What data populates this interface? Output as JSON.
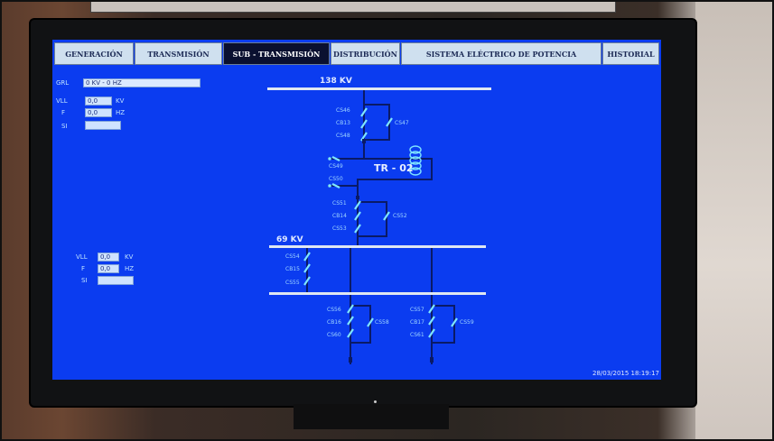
{
  "tabs": [
    {
      "label": "GENERACIÓN",
      "active": false
    },
    {
      "label": "TRANSMISIÓN",
      "active": false
    },
    {
      "label": "SUB - TRANSMISIÓN",
      "active": true
    },
    {
      "label": "DISTRIBUCIÓN",
      "active": false
    },
    {
      "label": "SISTEMA ELÉCTRICO DE POTENCIA",
      "active": false
    },
    {
      "label": "HISTORIAL",
      "active": false
    }
  ],
  "top_panel": {
    "status_label": "GRL",
    "status_value": "0 KV - 0 HZ",
    "vll_label": "VLL",
    "vll_value": "0,0",
    "vll_unit": "KV",
    "f_label": "F",
    "f_value": "0,0",
    "f_unit": "HZ",
    "si_label": "SI",
    "si_value": ""
  },
  "bottom_panel": {
    "vll_label": "VLL",
    "vll_value": "0,0",
    "vll_unit": "KV",
    "f_label": "F",
    "f_value": "0,0",
    "f_unit": "HZ",
    "si_label": "SI",
    "si_value": ""
  },
  "diagram": {
    "bus_138": "138 KV",
    "bus_69": "69 KV",
    "transformer": "TR - 02",
    "labels_upper": [
      "CS46",
      "CB13",
      "CS48",
      "CS47"
    ],
    "labels_mid": [
      "CS49",
      "CS50"
    ],
    "labels_lower": [
      "CS51",
      "CB14",
      "CS53",
      "CS52"
    ],
    "labels_69": [
      "CS54",
      "CB15",
      "CS55"
    ],
    "labels_feeder_a": [
      "CS56",
      "CB16",
      "CS60",
      "CS58"
    ],
    "labels_feeder_b": [
      "CS57",
      "CB17",
      "CS61",
      "CS59"
    ]
  },
  "timestamp": "28/03/2015 18:19:17",
  "colors": {
    "screen_bg": "#0b3cf0",
    "bus": "#dfe8f2",
    "line": "#0a1a66",
    "switch": "#7fe6ff",
    "active_tab": "#0a1030"
  }
}
